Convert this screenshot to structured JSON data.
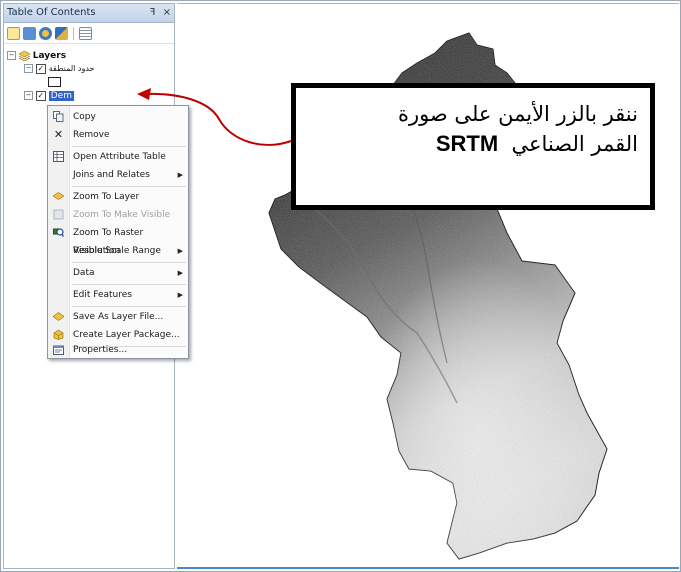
{
  "toc": {
    "title": "Table Of Contents",
    "pin_glyph": "ꟻ",
    "close_glyph": "×",
    "toolbar_icons": [
      "list-by-drawing-order-icon",
      "list-by-source-icon",
      "list-by-visibility-icon",
      "list-by-selection-icon",
      "options-icon"
    ],
    "layers_label": "Layers",
    "layer1_label": "حدود المنطقة",
    "layer2_label": "Dem"
  },
  "context_menu": {
    "items": [
      {
        "label": "Copy",
        "icon": "copy-icon"
      },
      {
        "label": "Remove",
        "icon": "remove-icon"
      },
      {
        "label": "Open Attribute Table",
        "icon": "table-icon"
      },
      {
        "label": "Joins and Relates",
        "submenu": true
      },
      {
        "label": "Zoom To Layer",
        "icon": "zoom-to-layer-icon"
      },
      {
        "label": "Zoom To Make Visible",
        "icon": "zoom-visible-icon",
        "disabled": true
      },
      {
        "label": "Zoom To Raster Resolution",
        "icon": "zoom-raster-icon"
      },
      {
        "label": "Visible Scale Range",
        "submenu": true
      },
      {
        "label": "Data",
        "submenu": true
      },
      {
        "label": "Edit Features",
        "submenu": true
      },
      {
        "label": "Save As Layer File...",
        "icon": "save-layer-icon"
      },
      {
        "label": "Create Layer Package...",
        "icon": "layer-package-icon"
      },
      {
        "label": "Properties...",
        "icon": "properties-icon"
      }
    ],
    "submenu_glyph": "▶"
  },
  "callout": {
    "line1": "ننقر بالزر الأيمن على صورة",
    "line2_prefix": "القمر الصناعي",
    "line2_strong": "SRTM"
  },
  "colors": {
    "arrow": "#c00000",
    "selection": "#3163c8"
  }
}
